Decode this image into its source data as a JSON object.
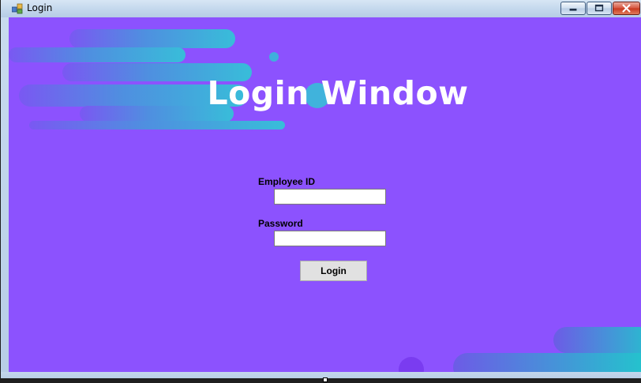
{
  "window": {
    "title": "Login",
    "controls": {
      "minimize": "minimize",
      "maximize": "maximize",
      "close": "close"
    }
  },
  "form": {
    "heading": "Login Window",
    "employee_id_label": "Employee ID",
    "employee_id_value": "",
    "password_label": "Password",
    "password_value": "",
    "login_button": "Login"
  },
  "colors": {
    "background": "#8c52fe",
    "decoration_gradient_start": "#6d5be6",
    "decoration_gradient_end": "#38bdd9",
    "accent_cyan": "#1ecbcb"
  }
}
